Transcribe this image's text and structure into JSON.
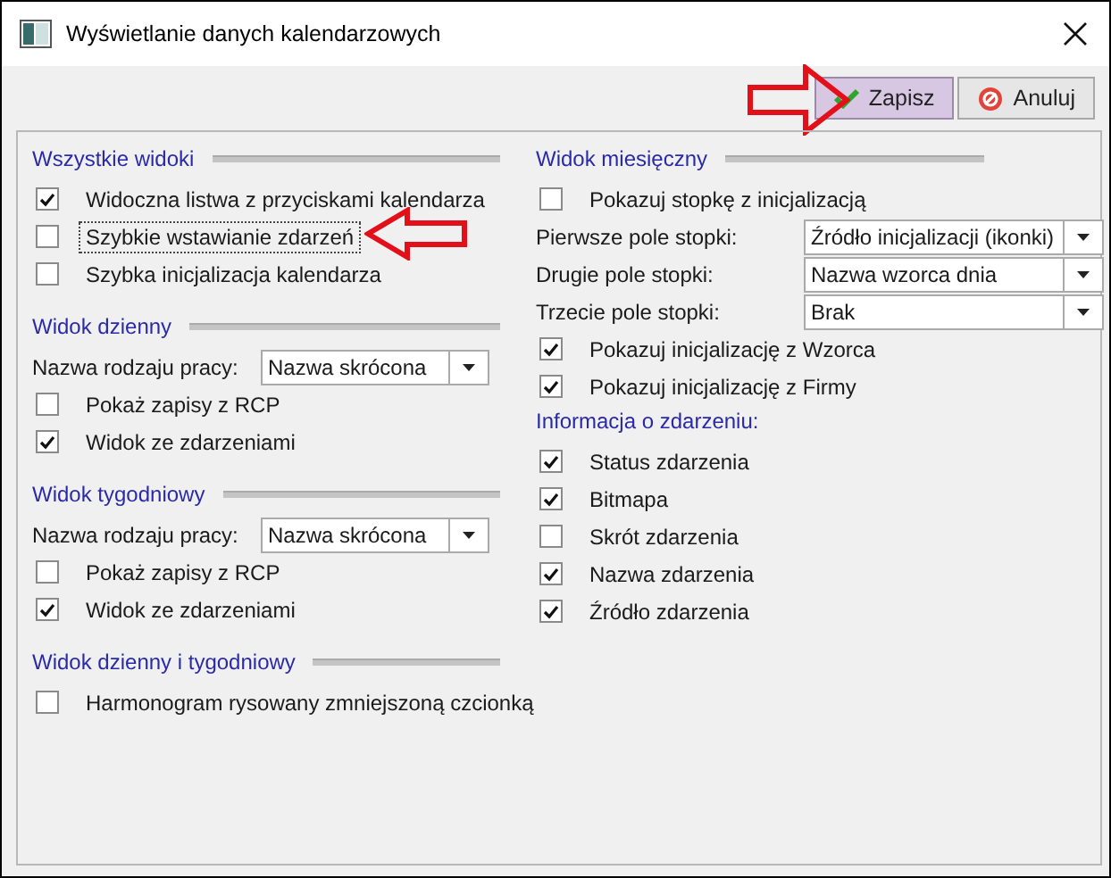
{
  "window": {
    "title": "Wyświetlanie danych kalendarzowych"
  },
  "toolbar": {
    "buttons": [
      {
        "label": "Zapisz",
        "kind": "save",
        "highlighted": true
      },
      {
        "label": "Anuluj",
        "kind": "cancel",
        "highlighted": false
      }
    ]
  },
  "columns": [
    [
      {
        "title": "Wszystkie widoki",
        "divider": true,
        "items": [
          {
            "kind": "check",
            "label": "Widoczna listwa z przyciskami kalendarza",
            "checked": true,
            "focused": false
          },
          {
            "kind": "check",
            "label": "Szybkie wstawianie zdarzeń",
            "checked": false,
            "focused": true
          },
          {
            "kind": "check",
            "label": "Szybka inicjalizacja kalendarza",
            "checked": false,
            "focused": false
          }
        ]
      },
      {
        "title": "Widok dzienny",
        "divider": true,
        "items": [
          {
            "kind": "combo",
            "label": "Nazwa rodzaju pracy:",
            "value": "Nazwa skrócona"
          },
          {
            "kind": "check",
            "label": "Pokaż zapisy z RCP",
            "checked": false,
            "focused": false
          },
          {
            "kind": "check",
            "label": "Widok ze zdarzeniami",
            "checked": true,
            "focused": false
          }
        ]
      },
      {
        "title": "Widok tygodniowy",
        "divider": true,
        "items": [
          {
            "kind": "combo",
            "label": "Nazwa rodzaju pracy:",
            "value": "Nazwa skrócona"
          },
          {
            "kind": "check",
            "label": "Pokaż zapisy z RCP",
            "checked": false,
            "focused": false
          },
          {
            "kind": "check",
            "label": "Widok ze zdarzeniami",
            "checked": true,
            "focused": false
          }
        ]
      },
      {
        "title": "Widok dzienny i tygodniowy",
        "divider": true,
        "items": [
          {
            "kind": "check",
            "label": "Harmonogram rysowany zmniejszoną czcionką",
            "checked": false,
            "focused": false
          }
        ]
      }
    ],
    [
      {
        "title": "Widok miesięczny",
        "divider": true,
        "items": [
          {
            "kind": "check",
            "label": "Pokazuj stopkę z inicjalizacją",
            "checked": false,
            "focused": false
          },
          {
            "kind": "combo",
            "label": "Pierwsze pole stopki:",
            "value": "Źródło inicjalizacji (ikonki)"
          },
          {
            "kind": "combo",
            "label": "Drugie pole stopki:",
            "value": "Nazwa wzorca dnia"
          },
          {
            "kind": "combo",
            "label": "Trzecie pole stopki:",
            "value": "Brak"
          },
          {
            "kind": "check",
            "label": "Pokazuj inicjalizację z Wzorca",
            "checked": true,
            "focused": false
          },
          {
            "kind": "check",
            "label": "Pokazuj inicjalizację z Firmy",
            "checked": true,
            "focused": false
          }
        ]
      },
      {
        "title": "Informacja o zdarzeniu:",
        "divider": false,
        "items": [
          {
            "kind": "check",
            "label": "Status zdarzenia",
            "checked": true,
            "focused": false
          },
          {
            "kind": "check",
            "label": "Bitmapa",
            "checked": true,
            "focused": false
          },
          {
            "kind": "check",
            "label": "Skrót zdarzenia",
            "checked": false,
            "focused": false
          },
          {
            "kind": "check",
            "label": "Nazwa zdarzenia",
            "checked": true,
            "focused": false
          },
          {
            "kind": "check",
            "label": "Źródło zdarzenia",
            "checked": true,
            "focused": false
          }
        ]
      }
    ]
  ]
}
